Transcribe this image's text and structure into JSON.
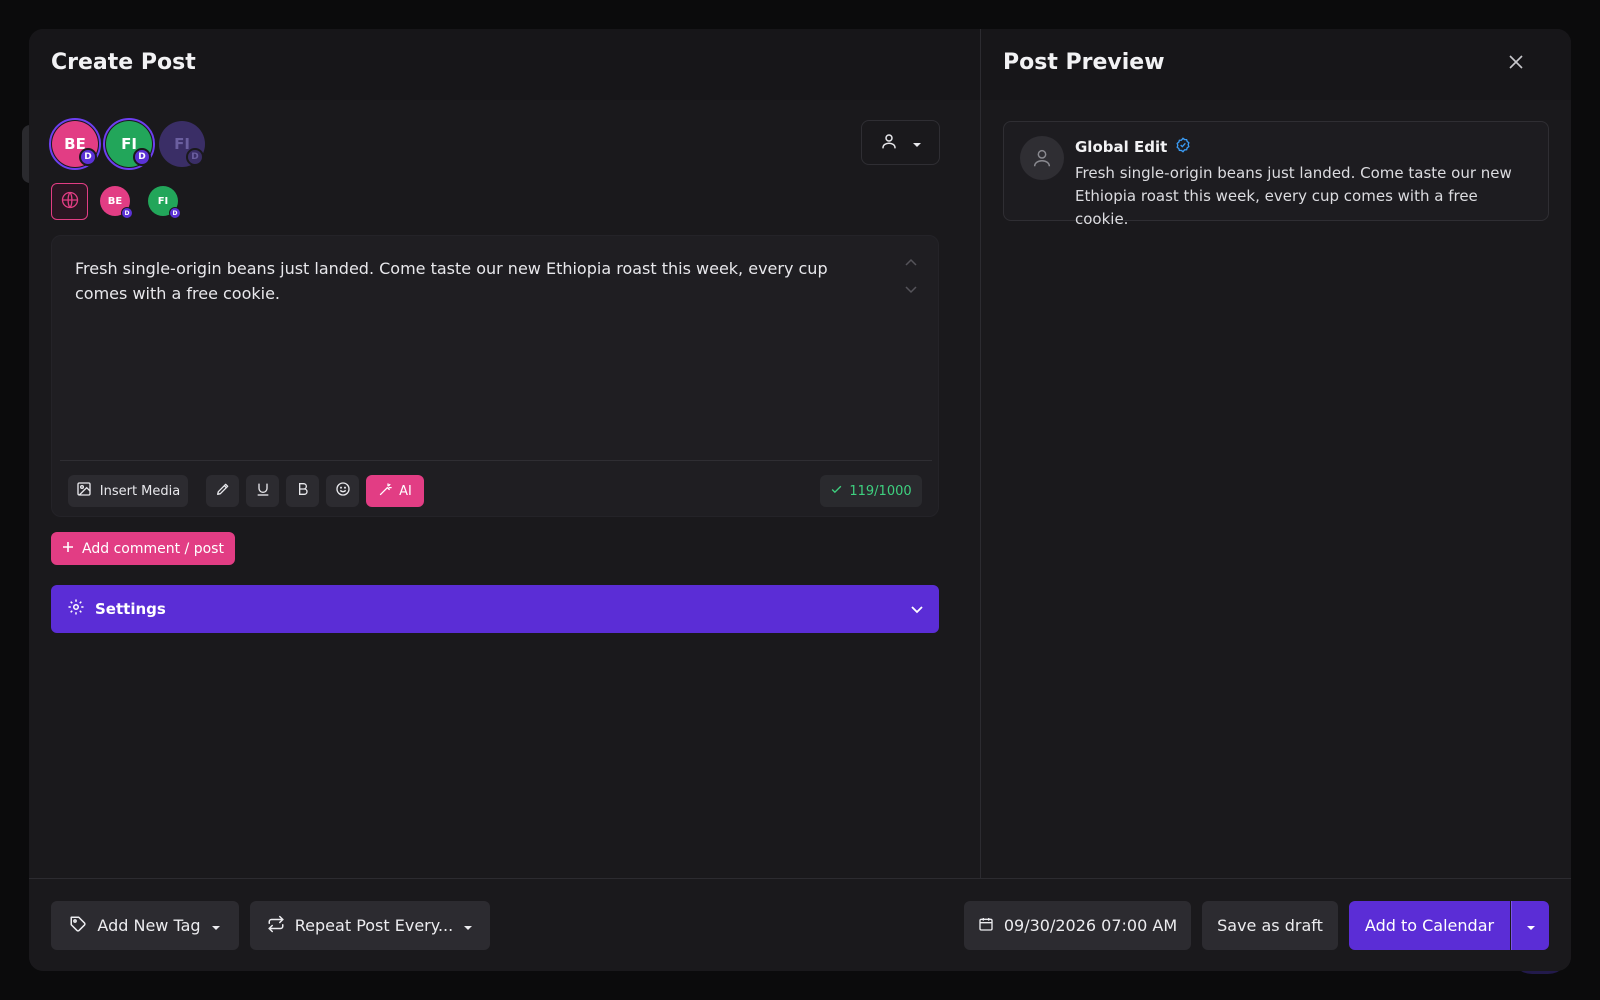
{
  "header": {
    "title": "Create Post"
  },
  "accounts": [
    {
      "initials": "BE",
      "color": "#e23d84",
      "badge": "D",
      "selected": true
    },
    {
      "initials": "FI",
      "color": "#22a65a",
      "badge": "D",
      "selected": true
    },
    {
      "initials": "FI",
      "color": "#3a2e66",
      "badge": "D",
      "selected": false
    }
  ],
  "channels": [
    {
      "initials": "BE",
      "color": "#e23d84",
      "badge": "D"
    },
    {
      "initials": "FI",
      "color": "#22a65a",
      "badge": "D"
    }
  ],
  "editor": {
    "text": "Fresh single-origin beans just landed. Come taste our new Ethiopia roast this week, every cup comes with a free cookie.",
    "insert_media_label": "Insert Media",
    "ai_label": "AI",
    "char_count": "119/1000"
  },
  "actions": {
    "add_comment_label": "Add comment / post"
  },
  "settings": {
    "label": "Settings"
  },
  "preview": {
    "title": "Post Preview",
    "account_name": "Global Edit",
    "text": "Fresh single-origin beans just landed. Come taste our new Ethiopia roast this week, every cup comes with a free cookie."
  },
  "footer": {
    "add_tag_label": "Add New Tag",
    "repeat_label": "Repeat Post Every...",
    "datetime": "09/30/2026 07:00 AM",
    "save_draft_label": "Save as draft",
    "add_calendar_label": "Add to Calendar"
  },
  "colors": {
    "accent_purple": "#5b2dd6",
    "accent_pink": "#e23d84",
    "success_green": "#3ed07f",
    "verified_blue": "#3b9cf5"
  }
}
